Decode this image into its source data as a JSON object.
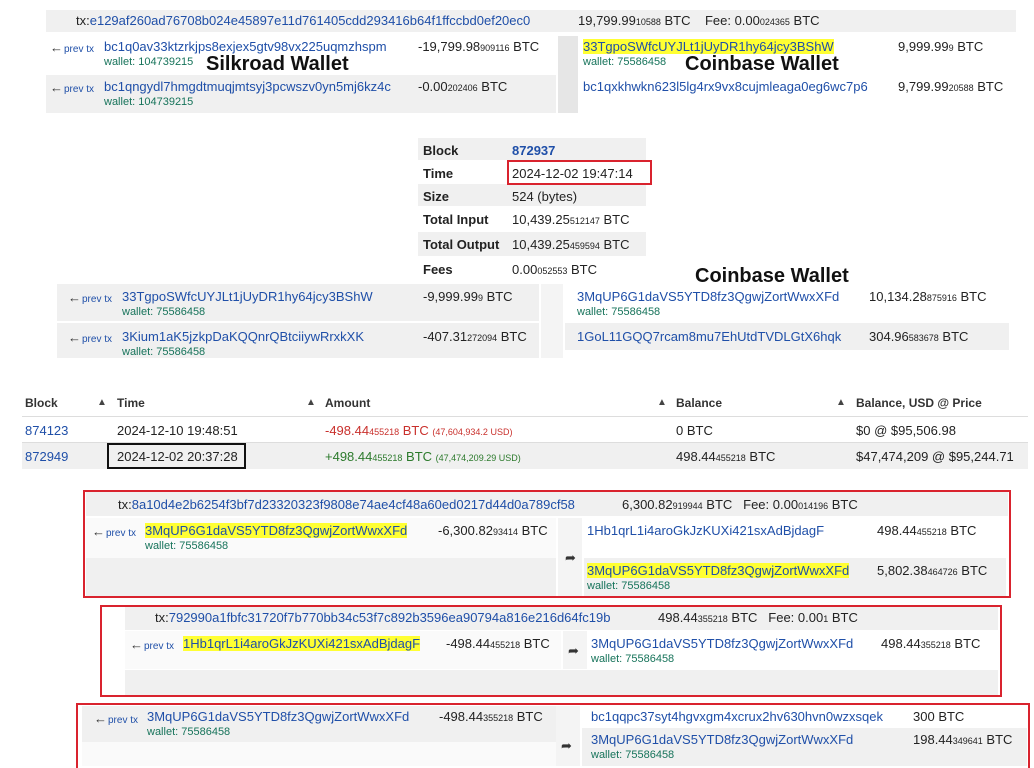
{
  "tx1": {
    "prefix": "tx:",
    "txid": "e129af260ad76708b024e45897e11d761405cdd293416b64f1ffccbd0ef20ec0",
    "total_main": "19,799.99",
    "total_small": "10588",
    "total_unit": " BTC",
    "fee_label": "Fee: ",
    "fee_main": "0.00",
    "fee_small": "024365",
    "fee_unit": " BTC",
    "inputs": [
      {
        "prev": "prev tx",
        "addr": "bc1q0av33ktzrkjps8exjex5gtv98vx225uqmzhspm",
        "wallet": "wallet: 104739215",
        "amt_main": "-19,799.98",
        "amt_small": "909116",
        "unit": " BTC"
      },
      {
        "prev": "prev tx",
        "addr": "bc1qngydl7hmgdtmuqjmtsyj3pcwszv0yn5mj6kz4c",
        "wallet": "wallet: 104739215",
        "amt_main": "-0.00",
        "amt_small": "202406",
        "unit": " BTC"
      }
    ],
    "outputs": [
      {
        "addr": "33TgpoSWfcUYJLt1jUyDR1hy64jcy3BShW",
        "wallet": "wallet: 75586458",
        "amt_main": "9,999.99",
        "amt_small": "9",
        "unit": " BTC"
      },
      {
        "addr": "bc1qxkhwkn623l5lg4rx9vx8cujmleaga0eg6wc7p6",
        "amt_main": "9,799.99",
        "amt_small": "20588",
        "unit": " BTC"
      }
    ],
    "label_left": "Silkroad Wallet",
    "label_right": "Coinbase Wallet"
  },
  "block_info": {
    "rows": [
      {
        "k": "Block",
        "v": "872937"
      },
      {
        "k": "Time",
        "v": "2024-12-02 19:47:14"
      },
      {
        "k": "Size",
        "v": "524 (bytes)"
      },
      {
        "k": "Total Input",
        "v_main": "10,439.25",
        "v_small": "512147",
        "unit": " BTC"
      },
      {
        "k": "Total Output",
        "v_main": "10,439.25",
        "v_small": "459594",
        "unit": " BTC"
      },
      {
        "k": "Fees",
        "v_main": "0.00",
        "v_small": "052553",
        "unit": " BTC"
      }
    ]
  },
  "tx2": {
    "label_right": "Coinbase Wallet",
    "inputs": [
      {
        "prev": "prev tx",
        "addr": "33TgpoSWfcUYJLt1jUyDR1hy64jcy3BShW",
        "wallet": "wallet: 75586458",
        "amt_main": "-9,999.99",
        "amt_small": "9",
        "unit": " BTC"
      },
      {
        "prev": "prev tx",
        "addr": "3Kium1aK5jzkpDaKQQnrQBtciiywRrxkXK",
        "wallet": "wallet: 75586458",
        "amt_main": "-407.31",
        "amt_small": "272094",
        "unit": " BTC"
      }
    ],
    "outputs": [
      {
        "addr": "3MqUP6G1daVS5YTD8fz3QgwjZortWwxXFd",
        "wallet": "wallet: 75586458",
        "amt_main": "10,134.28",
        "amt_small": "875916",
        "unit": " BTC"
      },
      {
        "addr": "1GoL11GQQ7rcam8mu7EhUtdTVDLGtX6hqk",
        "amt_main": "304.96",
        "amt_small": "583678",
        "unit": " BTC"
      }
    ]
  },
  "history": {
    "headers": [
      "Block",
      "Time",
      "Amount",
      "Balance",
      "Balance, USD @ Price"
    ],
    "rows": [
      {
        "block": "874123",
        "time": "2024-12-10 19:48:51",
        "amt_main": "-498.44",
        "amt_small": "455218",
        "amt_unit": " BTC",
        "usd": "(47,604,934.2 USD)",
        "bal": "0 BTC",
        "bal_small": "",
        "bal_unit": "",
        "usd_bal": "$0 @ $95,506.98"
      },
      {
        "block": "872949",
        "time": "2024-12-02 20:37:28",
        "amt_main": "+498.44",
        "amt_small": "455218",
        "amt_unit": " BTC",
        "usd": "(47,474,209.29 USD)",
        "bal": "498.44",
        "bal_small": "455218",
        "bal_unit": " BTC",
        "usd_bal": "$47,474,209 @ $95,244.71"
      }
    ]
  },
  "tx3": {
    "prefix": "tx:",
    "txid": "8a10d4e2b6254f3bf7d23320323f9808e74ae4cf48a60ed0217d44d0a789cf58",
    "total_main": "6,300.82",
    "total_small": "919944",
    "total_unit": " BTC",
    "fee_label": "Fee: ",
    "fee_main": "0.00",
    "fee_small": "014196",
    "fee_unit": " BTC",
    "input": {
      "prev": "prev tx",
      "addr": "3MqUP6G1daVS5YTD8fz3QgwjZortWwxXFd",
      "wallet": "wallet: 75586458",
      "amt_main": "-6,300.82",
      "amt_small": "93414",
      "unit": " BTC"
    },
    "outputs": [
      {
        "addr": "1Hb1qrL1i4aroGkJzKUXi421sxAdBjdagF",
        "amt_main": "498.44",
        "amt_small": "455218",
        "unit": " BTC"
      },
      {
        "addr": "3MqUP6G1daVS5YTD8fz3QgwjZortWwxXFd",
        "wallet": "wallet: 75586458",
        "amt_main": "5,802.38",
        "amt_small": "464726",
        "unit": " BTC"
      }
    ]
  },
  "tx4": {
    "prefix": "tx:",
    "txid": "792990a1fbfc31720f7b770bb34c53f7c892b3596ea90794a816e216d64fc19b",
    "total_main": "498.44",
    "total_small": "355218",
    "total_unit": " BTC",
    "fee_label": "Fee: ",
    "fee_main": "0.00",
    "fee_small": "1",
    "fee_unit": " BTC",
    "input": {
      "prev": "prev tx",
      "addr": "1Hb1qrL1i4aroGkJzKUXi421sxAdBjdagF",
      "amt_main": "-498.44",
      "amt_small": "455218",
      "unit": " BTC"
    },
    "output": {
      "addr": "3MqUP6G1daVS5YTD8fz3QgwjZortWwxXFd",
      "wallet": "wallet: 75586458",
      "amt_main": "498.44",
      "amt_small": "355218",
      "unit": " BTC"
    }
  },
  "tx5": {
    "input": {
      "prev": "prev tx",
      "addr": "3MqUP6G1daVS5YTD8fz3QgwjZortWwxXFd",
      "wallet": "wallet: 75586458",
      "amt_main": "-498.44",
      "amt_small": "355218",
      "unit": " BTC"
    },
    "outputs": [
      {
        "addr": "bc1qqpc37syt4hgvxgm4xcrux2hv630hvn0wzxsqek",
        "amt_main": "300",
        "amt_small": "",
        "unit": " BTC"
      },
      {
        "addr": "3MqUP6G1daVS5YTD8fz3QgwjZortWwxXFd",
        "wallet": "wallet: 75586458",
        "amt_main": "198.44",
        "amt_small": "349641",
        "unit": " BTC"
      }
    ]
  },
  "icons": {
    "prev_arrow": "left-arrow-icon",
    "forward": "share-forward-icon",
    "sort": "sort-icon"
  },
  "colors": {
    "highlight": "#ffff33",
    "red_box": "#d9232e",
    "link": "#1f4fa8",
    "wallet": "#16735a"
  }
}
